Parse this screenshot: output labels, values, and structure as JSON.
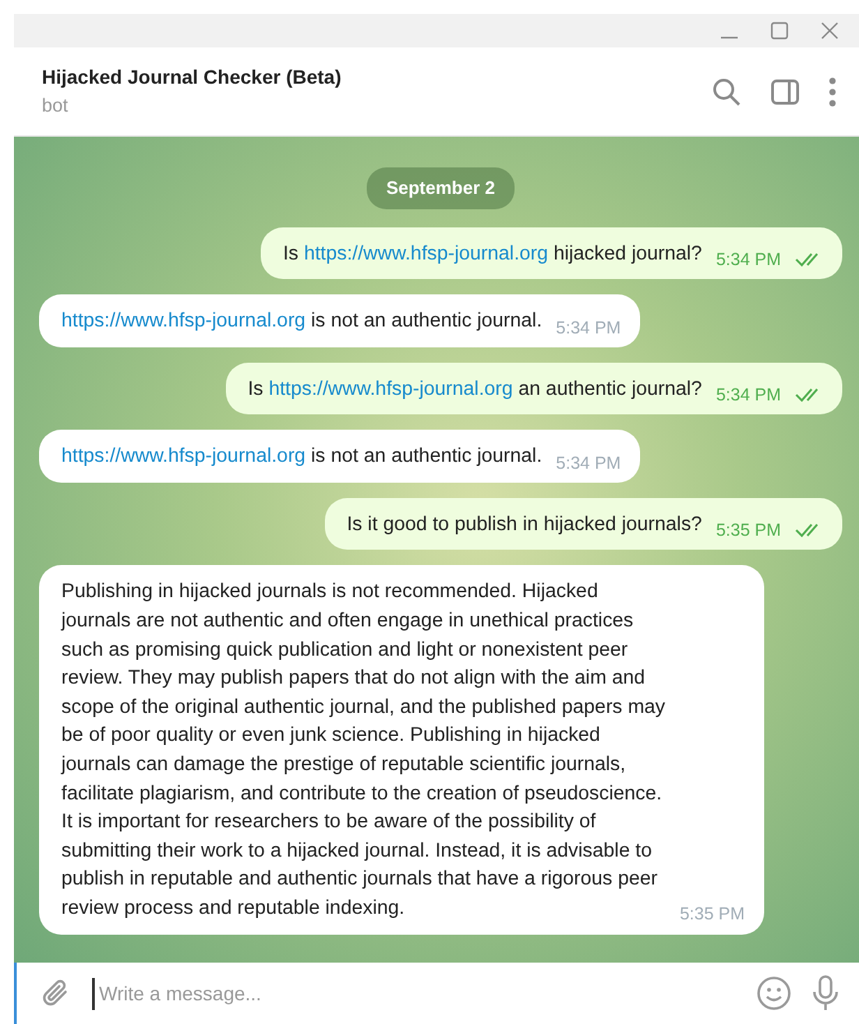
{
  "header": {
    "title": "Hijacked Journal Checker (Beta)",
    "subtitle": "bot"
  },
  "date": "September 2",
  "messages": [
    {
      "kind": "out",
      "parts": [
        {
          "kind": "text",
          "text": "Is "
        },
        {
          "kind": "link",
          "text": "https://www.hfsp-journal.org"
        },
        {
          "kind": "text",
          "text": " hijacked journal?"
        }
      ],
      "time": "5:34 PM",
      "read": true
    },
    {
      "kind": "in",
      "parts": [
        {
          "kind": "link",
          "text": "https://www.hfsp-journal.org"
        },
        {
          "kind": "text",
          "text": " is not an authentic journal."
        }
      ],
      "time": "5:34 PM"
    },
    {
      "kind": "out",
      "parts": [
        {
          "kind": "text",
          "text": "Is "
        },
        {
          "kind": "link",
          "text": "https://www.hfsp-journal.org"
        },
        {
          "kind": "text",
          "text": " an authentic journal?"
        }
      ],
      "time": "5:34 PM",
      "read": true
    },
    {
      "kind": "in",
      "parts": [
        {
          "kind": "link",
          "text": "https://www.hfsp-journal.org"
        },
        {
          "kind": "text",
          "text": " is not an authentic journal."
        }
      ],
      "time": "5:34 PM"
    },
    {
      "kind": "out",
      "parts": [
        {
          "kind": "text",
          "text": "Is it good to publish in hijacked journals?"
        }
      ],
      "time": "5:35 PM",
      "read": true
    },
    {
      "kind": "in",
      "parts": [
        {
          "kind": "text",
          "text": "Publishing in hijacked journals is not recommended. Hijacked journals are not authentic and often engage in unethical practices such as promising quick publication and light or nonexistent peer review. They may publish papers that do not align with the aim and scope of the original authentic journal, and the published papers may be of poor quality or even junk science. Publishing in hijacked journals can damage the prestige of reputable scientific journals, facilitate plagiarism, and contribute to the creation of pseudoscience. It is important for researchers to be aware of the possibility of submitting their work to a hijacked journal. Instead, it is advisable to publish in reputable and authentic journals that have a rigorous peer review process and reputable indexing."
        }
      ],
      "time": "5:35 PM"
    }
  ],
  "composer": {
    "placeholder": "Write a message..."
  }
}
